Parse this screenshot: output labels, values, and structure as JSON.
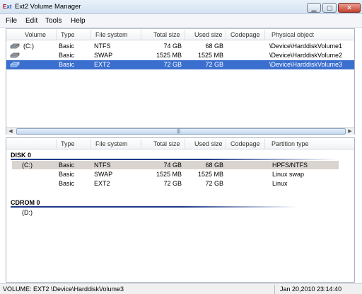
{
  "window": {
    "title": "Ext2 Volume Manager",
    "icon_text": "E",
    "icon_text2": "xt"
  },
  "menu": [
    "File",
    "Edit",
    "Tools",
    "Help"
  ],
  "volumes": {
    "columns": [
      "Volume",
      "Type",
      "File system",
      "Total size",
      "Used size",
      "Codepage",
      "Physical object"
    ],
    "rows": [
      {
        "volume": "(C:)",
        "type": "Basic",
        "fs": "NTFS",
        "total": "74 GB",
        "used": "68 GB",
        "codepage": "",
        "object": "\\Device\\HarddiskVolume1",
        "selected": false
      },
      {
        "volume": "",
        "type": "Basic",
        "fs": "SWAP",
        "total": "1525 MB",
        "used": "1525 MB",
        "codepage": "",
        "object": "\\Device\\HarddiskVolume2",
        "selected": false
      },
      {
        "volume": "",
        "type": "Basic",
        "fs": "EXT2",
        "total": "72 GB",
        "used": "72 GB",
        "codepage": "",
        "object": "\\Device\\HarddiskVolume3",
        "selected": true
      }
    ]
  },
  "disks": {
    "columns": [
      "Type",
      "File system",
      "Total size",
      "Used size",
      "Codepage",
      "Partition type"
    ],
    "disk0": {
      "title": "DISK 0",
      "rows": [
        {
          "volume": "(C:)",
          "type": "Basic",
          "fs": "NTFS",
          "total": "74 GB",
          "used": "68 GB",
          "codepage": "",
          "ptype": "HPFS/NTFS"
        },
        {
          "volume": "",
          "type": "Basic",
          "fs": "SWAP",
          "total": "1525 MB",
          "used": "1525 MB",
          "codepage": "",
          "ptype": "Linux swap"
        },
        {
          "volume": "",
          "type": "Basic",
          "fs": "EXT2",
          "total": "72 GB",
          "used": "72 GB",
          "codepage": "",
          "ptype": "Linux"
        }
      ]
    },
    "cdrom0": {
      "title": "CDROM 0",
      "rows": [
        {
          "volume": "(D:)"
        }
      ]
    }
  },
  "status": {
    "volume": "VOLUME:  EXT2 \\Device\\HarddiskVolume3",
    "datetime": "Jan 20,2010 23:14:40"
  },
  "glyphs": {
    "minimize": "▁",
    "maximize": "▢",
    "close": "✕",
    "left": "◀",
    "right": "▶",
    "grip": "|||"
  }
}
